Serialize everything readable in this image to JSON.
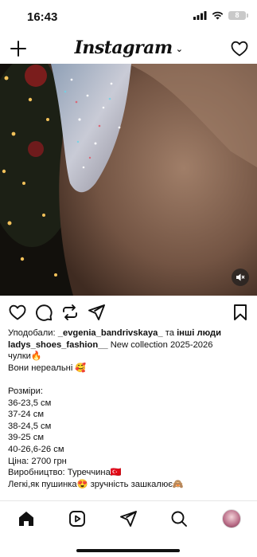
{
  "status": {
    "time": "16:43",
    "battery": "8"
  },
  "header": {
    "logo": "Instagram",
    "chevron": "⌄"
  },
  "icons": {
    "new_post": "plus-icon",
    "notifications": "heart-icon",
    "like": "heart-icon",
    "comment": "comment-icon",
    "repost": "repost-icon",
    "share": "send-icon",
    "save": "bookmark-icon",
    "mute": "speaker-muted-icon"
  },
  "post": {
    "liked_by_prefix": "Уподобали: ",
    "liked_by_user": "_evgenia_bandrivskaya_",
    "liked_by_and": " та ",
    "liked_by_others": "інші люди",
    "author": "ladys_shoes_fashion__",
    "caption_lines": [
      " New collection  2025-2026",
      "чулки🔥",
      "Вони нереальні 🥰",
      "",
      "Розміри:",
      "36-23,5 см",
      "37-24 см",
      "38-24,5 см",
      "39-25 см",
      "40-26,6-26 см",
      "Ціна: 2700 грн",
      "Виробництво: Туреччина🇹🇷",
      "Легкі,як пушинка😍 зручність зашкалює🙈"
    ]
  },
  "tabbar": {
    "items": [
      "home-icon",
      "reels-icon",
      "send-icon",
      "search-icon",
      "profile-avatar"
    ]
  }
}
